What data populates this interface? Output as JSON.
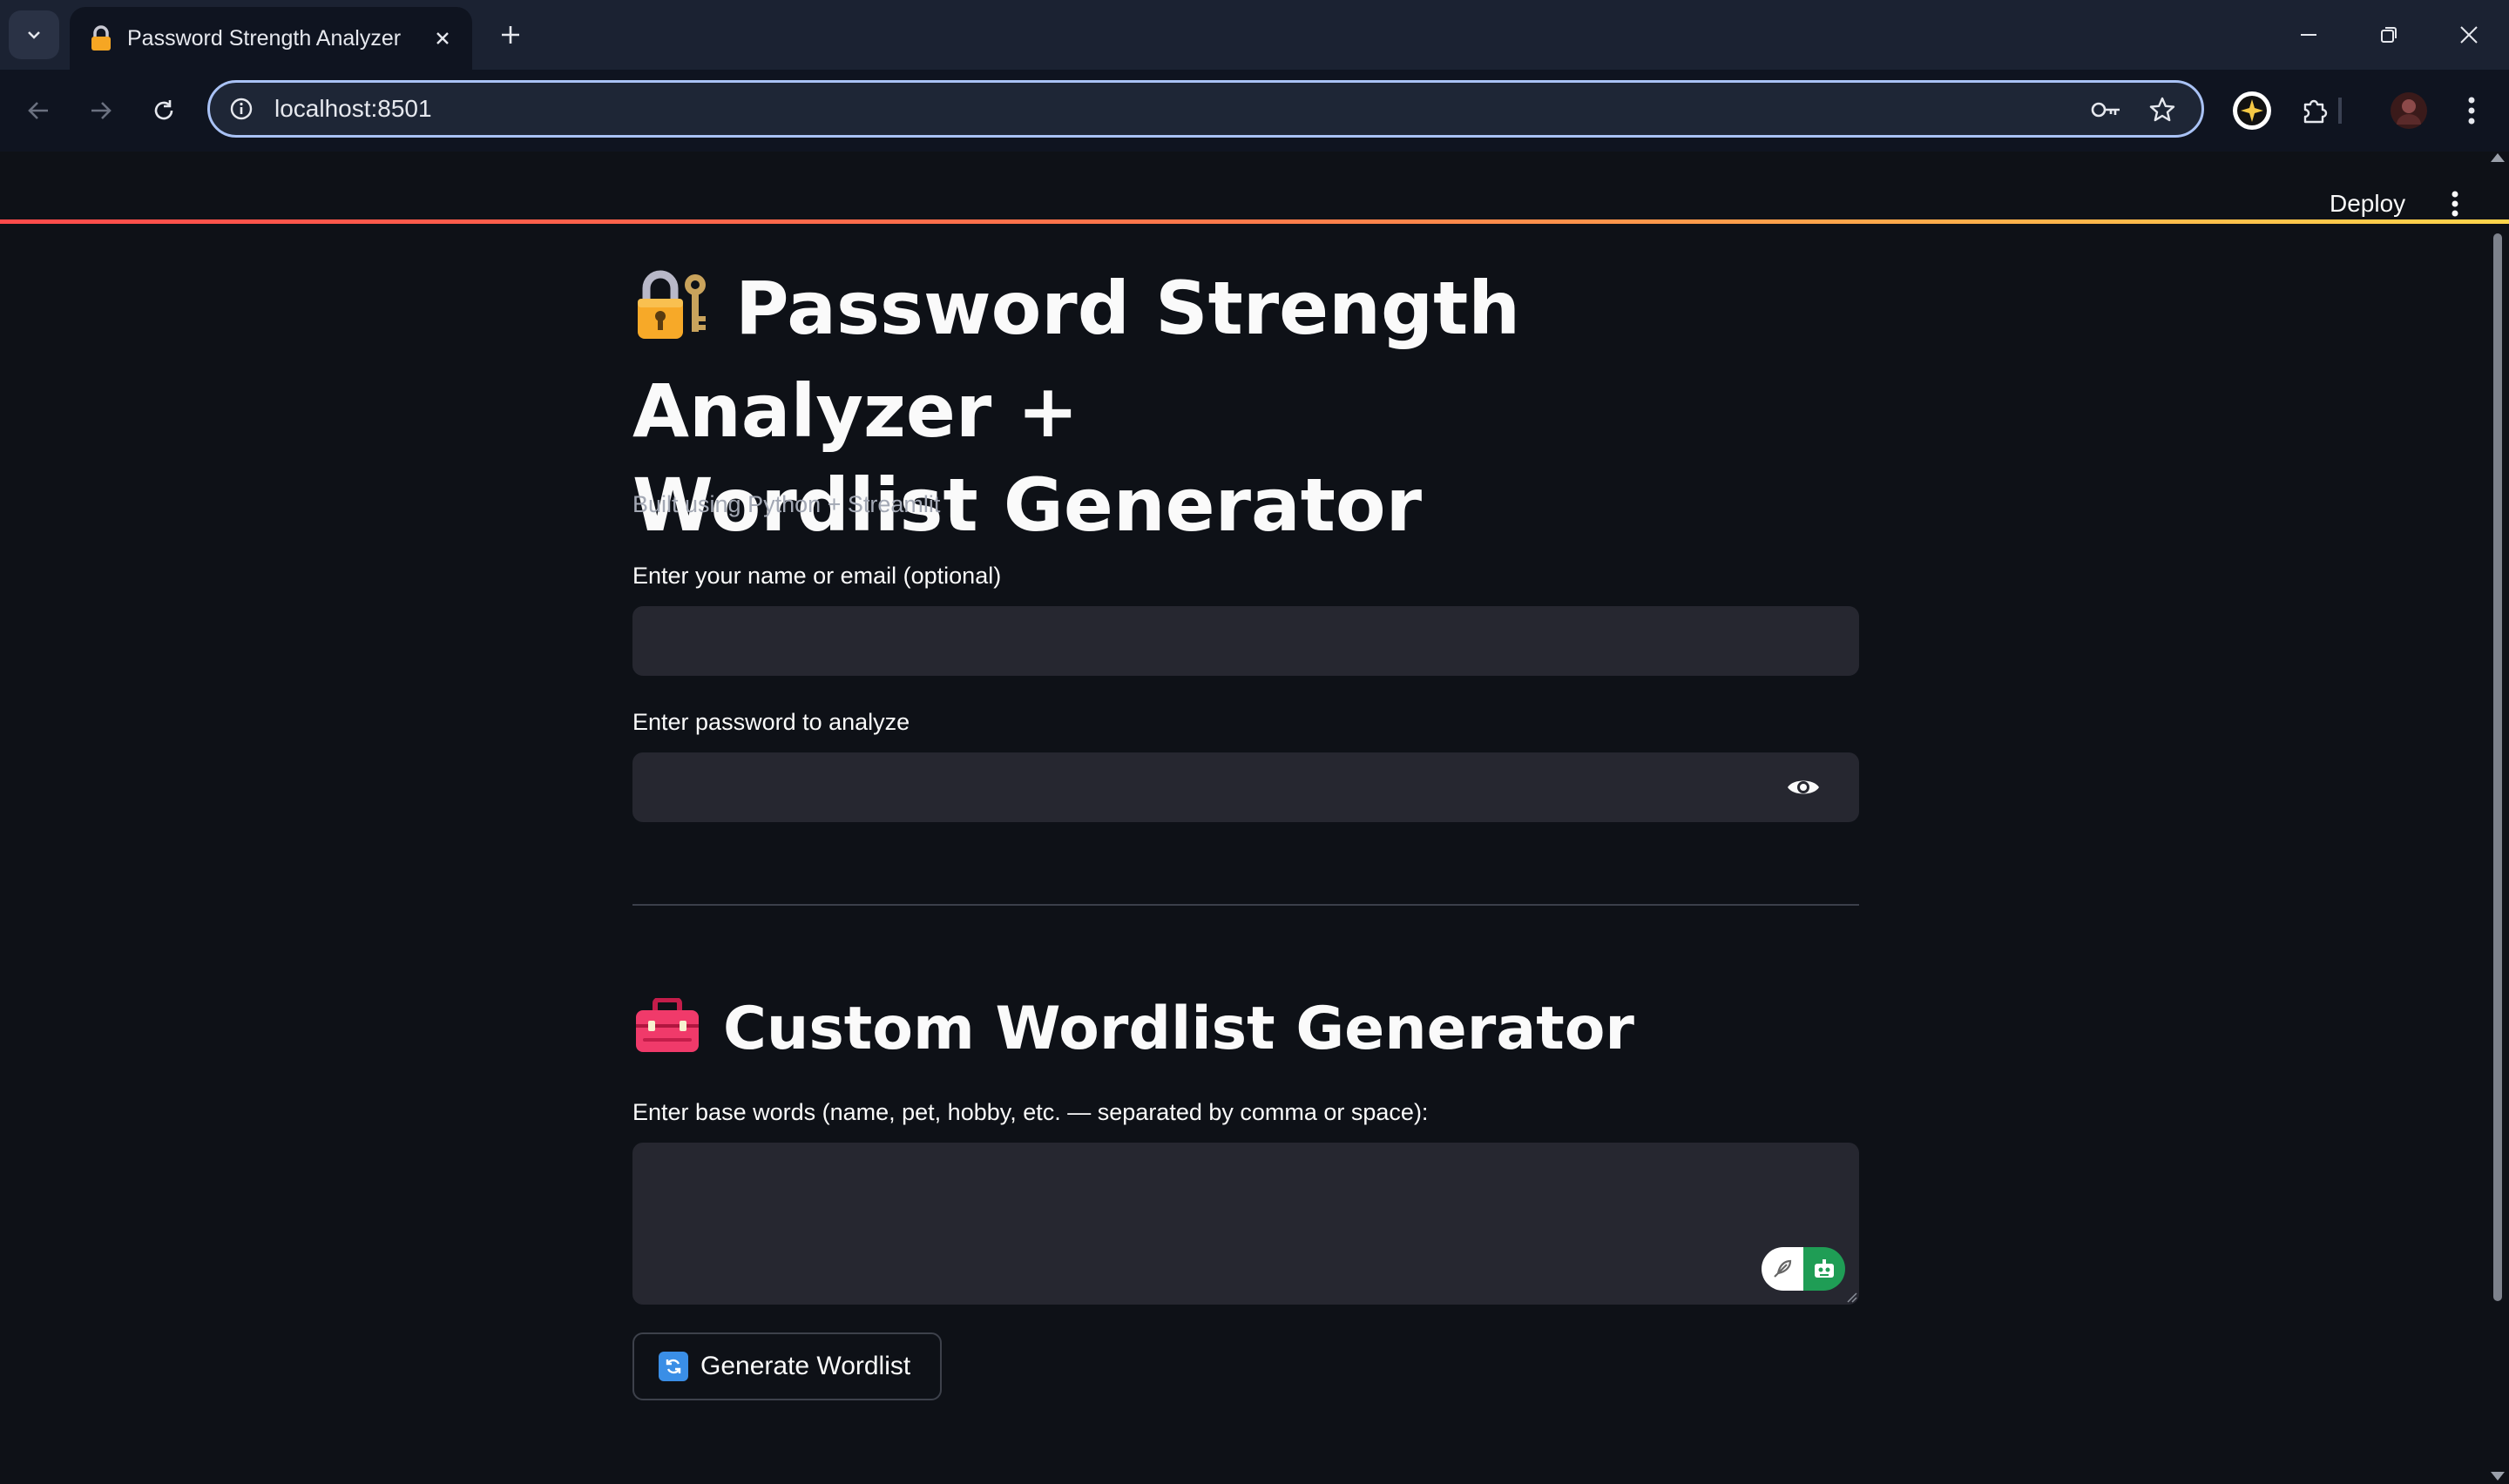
{
  "browser": {
    "tab_title": "Password Strength Analyzer",
    "url": "localhost:8501"
  },
  "app": {
    "deploy_label": "Deploy",
    "title_line1": "Password Strength Analyzer +",
    "title_line2": "Wordlist Generator",
    "caption": "Built using Python + Streamlit",
    "name_label": "Enter your name or email (optional)",
    "name_value": "",
    "password_label": "Enter password to analyze",
    "password_value": "",
    "wordlist_heading": "Custom Wordlist Generator",
    "base_words_label": "Enter base words (name, pet, hobby, etc. — separated by comma or space):",
    "base_words_value": "",
    "generate_button": "Generate Wordlist"
  },
  "icons": {
    "title_emoji": "locked-with-key-icon",
    "wordlist_emoji": "toolbox-icon",
    "button_emoji": "counterclockwise-arrows-icon"
  },
  "colors": {
    "background": "#0e1117",
    "input_bg": "#262730",
    "accent": "#ff4b4b"
  }
}
